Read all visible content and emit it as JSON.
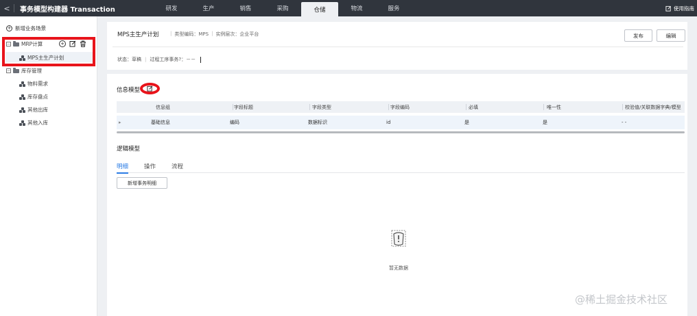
{
  "topbar": {
    "back_glyph": "<",
    "title": "事务模型构建器 Transaction",
    "tabs": [
      "研发",
      "生产",
      "销售",
      "采购",
      "仓储",
      "物流",
      "服务"
    ],
    "active_tab": "仓储",
    "help_label": "使用指南"
  },
  "sidebar": {
    "add_scene_label": "新增业务场景",
    "groups": [
      {
        "toggle": "−",
        "label": "MRP计算",
        "children": [
          "MPS主生产计划"
        ]
      },
      {
        "toggle": "−",
        "label": "库存管理",
        "children": [
          "物料需求",
          "库存盘点",
          "其他出库",
          "其他入库"
        ]
      }
    ],
    "selected_item": "MPS主生产计划"
  },
  "header": {
    "title": "MPS主生产计划",
    "type_code_label": "类型编码：MPS",
    "instance_level_label": "实例层次：企业平台",
    "status_label": "状态：草稿",
    "process_label": "过程工序事务?：－－",
    "publish_label": "发布",
    "edit_label": "编辑"
  },
  "info_model": {
    "title": "信息模型",
    "columns": [
      "信息组",
      "字段标题",
      "字段类型",
      "字段编码",
      "必填",
      "唯一性",
      "校验值/关联数据字典/模型"
    ],
    "rows": [
      [
        "基础信息",
        "编码",
        "数据标识",
        "id",
        "是",
        "是",
        "- -"
      ]
    ]
  },
  "logic_model": {
    "title": "逻辑模型",
    "tabs": [
      "明细",
      "操作",
      "流程"
    ],
    "active_tab": "明细",
    "add_detail_label": "新增事务明细",
    "empty_text": "暂无数据"
  },
  "watermark": "@稀土掘金技术社区",
  "colors": {
    "topbar_bg": "#30353d",
    "accent": "#2a7be4",
    "highlight_red": "#e8141b"
  }
}
